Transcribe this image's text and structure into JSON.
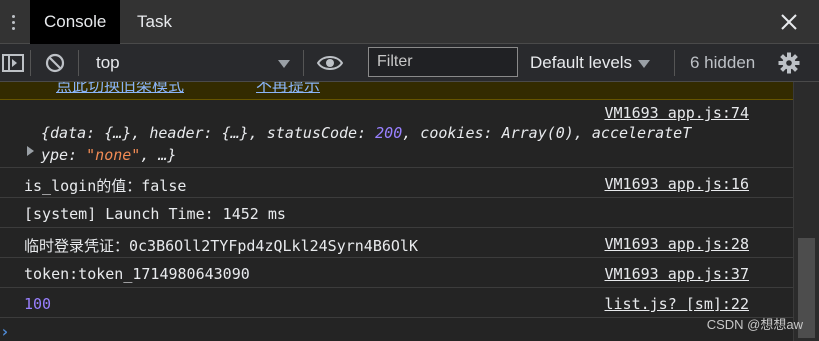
{
  "tabs": [
    {
      "label": "Console",
      "active": true
    },
    {
      "label": "Task",
      "active": false
    }
  ],
  "toolbar": {
    "context": "top",
    "filter_placeholder": "Filter",
    "levels_label": "Default levels",
    "hidden_count": "6 hidden"
  },
  "warning_cut": {
    "text_a": "点此切换旧架模式",
    "text_b": "不再提示"
  },
  "messages": [
    {
      "source": "VM1693 app.js:74",
      "object": {
        "line1_parts": [
          "{data: {…}, header: {…}, statusCode: ",
          "200",
          ", cookies: Array(0), accelerateT"
        ],
        "line2_parts": [
          "ype: ",
          "\"none\"",
          ", …}"
        ]
      }
    },
    {
      "text": "is_login的值：false",
      "source": "VM1693 app.js:16"
    },
    {
      "text": "[system] Launch Time: 1452 ms",
      "source": ""
    },
    {
      "text": "临时登录凭证：0c3B6Oll2TYFpd4zQLkl24Syrn4B6OlK",
      "source": "VM1693 app.js:28"
    },
    {
      "text": "token:token_1714980643090",
      "source": "VM1693 app.js:37"
    },
    {
      "text": "100",
      "source": "list.js? [sm]:22"
    }
  ],
  "prompt": "›",
  "watermark": "CSDN @想想aw",
  "colors": {
    "background": "#242424",
    "number": "#9980ff",
    "string": "#f28b54",
    "link": "#8ab4f8",
    "warning_bg": "#332b00"
  }
}
